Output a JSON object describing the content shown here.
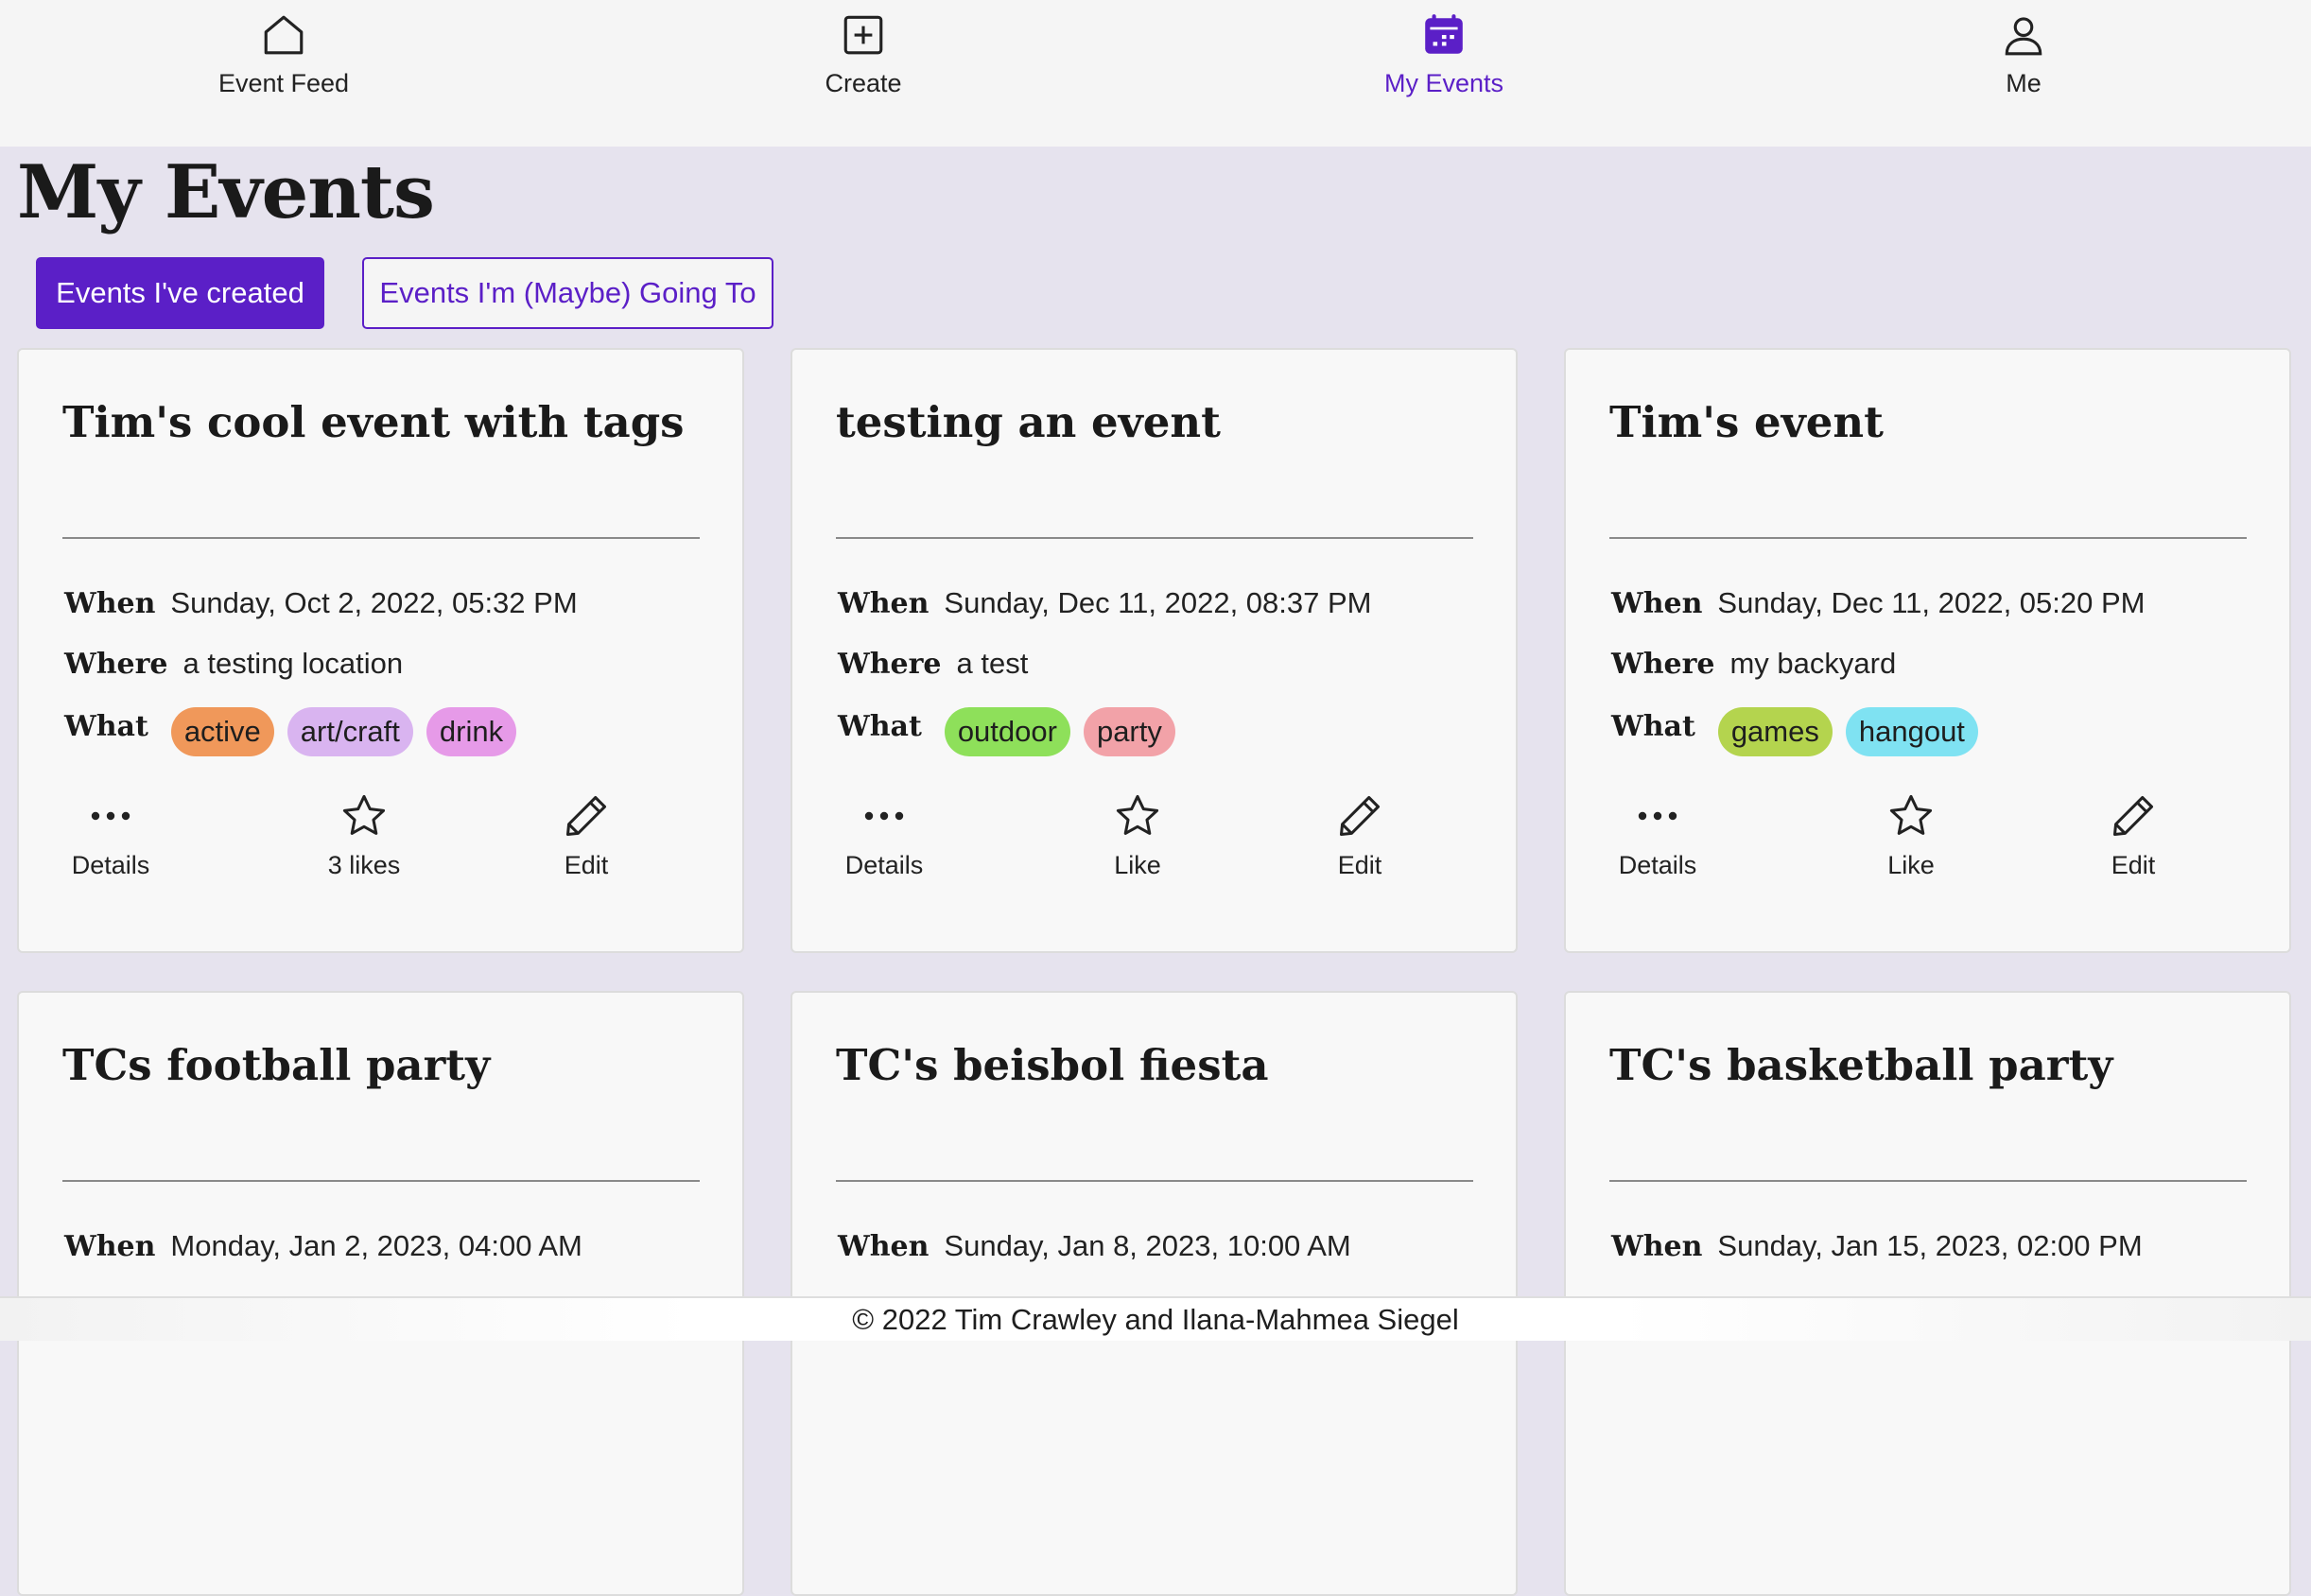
{
  "nav": {
    "items": [
      {
        "label": "Event Feed",
        "icon": "home-icon"
      },
      {
        "label": "Create",
        "icon": "plus-square-icon"
      },
      {
        "label": "My Events",
        "icon": "calendar-icon",
        "active": true
      },
      {
        "label": "Me",
        "icon": "user-icon"
      }
    ],
    "active_color": "#5b1fc7"
  },
  "page": {
    "title": "My Events",
    "tabs": [
      {
        "label": "Events I've created",
        "selected": true
      },
      {
        "label": "Events I'm (Maybe) Going To",
        "selected": false
      }
    ]
  },
  "labels": {
    "when": "When",
    "where": "Where",
    "what": "What",
    "details": "Details",
    "edit": "Edit"
  },
  "events": [
    {
      "title": "Tim's cool event with tags",
      "when": "Sunday, Oct 2, 2022, 05:32 PM",
      "where": "a testing location",
      "tags": [
        {
          "name": "active",
          "color": "#f0985a"
        },
        {
          "name": "art/craft",
          "color": "#d9b4f0"
        },
        {
          "name": "drink",
          "color": "#e69ae8"
        }
      ],
      "like_label": "3 likes"
    },
    {
      "title": "testing an event",
      "when": "Sunday, Dec 11, 2022, 08:37 PM",
      "where": "a test",
      "tags": [
        {
          "name": "outdoor",
          "color": "#8ee05a"
        },
        {
          "name": "party",
          "color": "#f2a2a8"
        }
      ],
      "like_label": "Like"
    },
    {
      "title": "Tim's event",
      "when": "Sunday, Dec 11, 2022, 05:20 PM",
      "where": "my backyard",
      "tags": [
        {
          "name": "games",
          "color": "#b4d44e"
        },
        {
          "name": "hangout",
          "color": "#7fe2f2"
        }
      ],
      "like_label": "Like"
    },
    {
      "title": "TCs football party",
      "when": "Monday, Jan 2, 2023, 04:00 AM"
    },
    {
      "title": "TC's beisbol fiesta",
      "when": "Sunday, Jan 8, 2023, 10:00 AM"
    },
    {
      "title": "TC's basketball party",
      "when": "Sunday, Jan 15, 2023, 02:00 PM"
    }
  ],
  "footer": {
    "text": "© 2022 Tim Crawley and Ilana-Mahmea Siegel"
  }
}
